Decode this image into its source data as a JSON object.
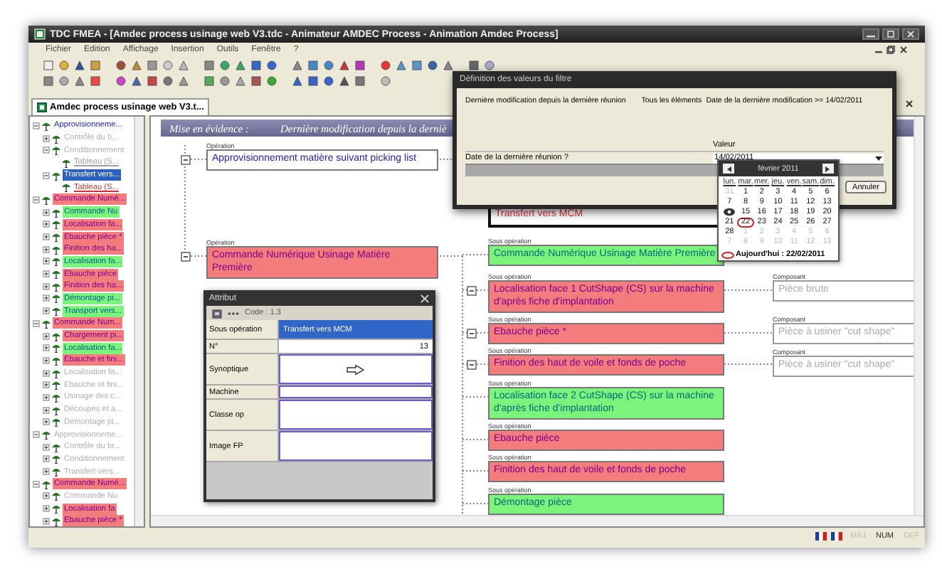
{
  "window": {
    "title": "TDC FMEA - [Amdec process usinage web V3.tdc - Animateur AMDEC Process - Animation Amdec Process]"
  },
  "menu": [
    "Fichier",
    "Edition",
    "Affichage",
    "Insertion",
    "Outils",
    "Fenêtre",
    "?"
  ],
  "document_tab": {
    "label": "Amdec process usinage web V3.t...",
    "selected": true
  },
  "tree": [
    {
      "text": "Approvisionneme...",
      "kind": "step",
      "expanded": true,
      "selected": false,
      "dimmed": false,
      "children": [
        {
          "text": "Contrôle du b...",
          "kind": "step",
          "expanded": false,
          "selected": false,
          "dimmed": true
        },
        {
          "text": "Conditionnement",
          "kind": "step",
          "expanded": true,
          "selected": false,
          "dimmed": true,
          "children": [
            {
              "text": "Tableau (S...",
              "kind": "document",
              "selected": false,
              "dimmed": true
            }
          ]
        },
        {
          "text": "Transfert vers...",
          "kind": "step",
          "expanded": true,
          "selected": true,
          "dimmed": false,
          "children": [
            {
              "text": "Tableau (S...",
              "kind": "document",
              "selected": false,
              "dimmed": false
            }
          ]
        }
      ]
    },
    {
      "text": "Commande Numé...",
      "kind": "step",
      "expanded": true,
      "selected": false,
      "dimmed": false,
      "color": "#f47c7c",
      "children": [
        {
          "text": "Commande Nu",
          "kind": "step",
          "expanded": false,
          "selected": false,
          "dimmed": false,
          "color": "#7cf47c"
        },
        {
          "text": "Localisation fa...",
          "kind": "step",
          "expanded": false,
          "selected": false,
          "dimmed": false,
          "color": "#f47c7c"
        },
        {
          "text": "Ebauche pièce *",
          "kind": "step",
          "expanded": false,
          "selected": false,
          "dimmed": false,
          "color": "#f47c7c"
        },
        {
          "text": "Finition des ha...",
          "kind": "step",
          "expanded": false,
          "selected": false,
          "dimmed": false,
          "color": "#f47c7c"
        },
        {
          "text": "Localisation fa...",
          "kind": "step",
          "expanded": false,
          "selected": false,
          "dimmed": false,
          "color": "#7cf47c"
        },
        {
          "text": "Ebauche pièce",
          "kind": "step",
          "expanded": false,
          "selected": false,
          "dimmed": false,
          "color": "#f47c7c"
        },
        {
          "text": "Finition des ha...",
          "kind": "step",
          "expanded": false,
          "selected": false,
          "dimmed": false,
          "color": "#f47c7c"
        },
        {
          "text": "Démontage pi...",
          "kind": "step",
          "expanded": false,
          "selected": false,
          "dimmed": false,
          "color": "#7cf47c"
        },
        {
          "text": "Transport vers...",
          "kind": "step",
          "expanded": false,
          "selected": false,
          "dimmed": false,
          "color": "#7cf47c"
        }
      ]
    },
    {
      "text": "Commande Num...",
      "kind": "step",
      "expanded": true,
      "selected": false,
      "dimmed": false,
      "color": "#f47c7c",
      "children": [
        {
          "text": "Chargement pi...",
          "kind": "step",
          "expanded": false,
          "selected": false,
          "dimmed": false,
          "color": "#f47c7c"
        },
        {
          "text": "Localisation fa...",
          "kind": "step",
          "expanded": false,
          "selected": false,
          "dimmed": false,
          "color": "#7cf47c"
        },
        {
          "text": "Ebauche et fini...",
          "kind": "step",
          "expanded": false,
          "selected": false,
          "dimmed": false,
          "color": "#f47c7c"
        },
        {
          "text": "Localisation fa...",
          "kind": "step",
          "expanded": false,
          "selected": false,
          "dimmed": true
        },
        {
          "text": "Ebauche et fini...",
          "kind": "step",
          "expanded": false,
          "selected": false,
          "dimmed": true
        },
        {
          "text": "Usinage des c...",
          "kind": "step",
          "expanded": false,
          "selected": false,
          "dimmed": true
        },
        {
          "text": "Découpes et a...",
          "kind": "step",
          "expanded": false,
          "selected": false,
          "dimmed": true
        },
        {
          "text": "Démontage pi...",
          "kind": "step",
          "expanded": false,
          "selected": false,
          "dimmed": true
        }
      ]
    },
    {
      "text": "Approvisionneme...",
      "kind": "step",
      "expanded": true,
      "selected": false,
      "dimmed": true,
      "children": [
        {
          "text": "Contrôle du br...",
          "kind": "step",
          "expanded": false,
          "selected": false,
          "dimmed": true
        },
        {
          "text": "Conditionnement",
          "kind": "step",
          "expanded": false,
          "selected": false,
          "dimmed": true
        },
        {
          "text": "Transfert vers...",
          "kind": "step",
          "expanded": false,
          "selected": false,
          "dimmed": true
        }
      ]
    },
    {
      "text": "Commande Numé...",
      "kind": "step",
      "expanded": true,
      "selected": false,
      "dimmed": false,
      "color": "#f47c7c",
      "children": [
        {
          "text": "Commande Nu",
          "kind": "step",
          "expanded": false,
          "selected": false,
          "dimmed": true
        },
        {
          "text": "Localisation fa",
          "kind": "step",
          "expanded": false,
          "selected": false,
          "dimmed": false,
          "color": "#f47c7c"
        },
        {
          "text": "Ebauche pièce *",
          "kind": "step",
          "expanded": false,
          "selected": false,
          "dimmed": false,
          "color": "#f47c7c"
        }
      ]
    }
  ],
  "highlight_bar": {
    "label": "Mise en évidence :",
    "text": "Dernière modification depuis la derniè"
  },
  "operations": [
    {
      "label": "Opération",
      "text": "Approvisionnement matière suivant picking list",
      "expanded": true,
      "selected": false
    },
    {
      "label": "Opération",
      "text": "Commande Numérique Usinage Matière Première",
      "expanded": true,
      "selected": false,
      "color": "#f47c7c"
    }
  ],
  "sub_operations": [
    {
      "text": "Transfert vers MCM",
      "selected": true
    },
    {
      "label": "Sous opération",
      "text": "Commande Numérique Usinage Matière Première",
      "selected": false,
      "color": "#7cf47c"
    },
    {
      "label": "Sous opération",
      "text": "Localisation face 1 CutShape (CS) sur la machine d'après fiche d'implantation",
      "expanded": true,
      "selected": false,
      "color": "#f47c7c",
      "component": {
        "label": "Composant",
        "text": "Pièce brute"
      }
    },
    {
      "label": "Sous opération",
      "text": "Ebauche pièce *",
      "expanded": true,
      "selected": false,
      "color": "#f47c7c",
      "component": {
        "label": "Composant",
        "text": "Pièce à usiner \"cut shape\""
      }
    },
    {
      "label": "Sous opération",
      "text": "Finition des haut de voile et fonds de poche",
      "expanded": true,
      "selected": false,
      "color": "#f47c7c",
      "component": {
        "label": "Composant",
        "text": "Pièce à usiner \"cut shape\""
      }
    },
    {
      "label": "Sous opération",
      "text": "Localisation face 2 CutShape (CS) sur la machine d'après fiche d'implantation",
      "selected": false,
      "color": "#7cf47c"
    },
    {
      "label": "Sous opération",
      "text": "Ebauche pièce",
      "selected": false,
      "color": "#f47c7c"
    },
    {
      "label": "Sous opération",
      "text": "Finition des haut de voile et fonds de poche",
      "selected": false,
      "color": "#f47c7c"
    },
    {
      "label": "Sous opération",
      "text": "Démontage pièce",
      "selected": false,
      "color": "#7cf47c"
    }
  ],
  "attribute_window": {
    "title": "Attribut",
    "code": "Code : 1.3",
    "rows": [
      {
        "label": "Sous opération",
        "value": "Transfert vers MCM",
        "kind": "text",
        "selected": true
      },
      {
        "label": "N°",
        "value": "13",
        "kind": "text",
        "selected": false
      },
      {
        "label": "Synoptique",
        "kind": "image",
        "selected": false
      },
      {
        "label": "Machine",
        "kind": "text",
        "selected": false
      },
      {
        "label": "Classe op",
        "kind": "text",
        "selected": false
      },
      {
        "label": "Image FP",
        "kind": "text",
        "selected": false
      }
    ]
  },
  "filter_dialog": {
    "title": "Définition des valeurs du filtre",
    "criterion": "Dernière modification depuis la dernière réunion",
    "scope": "Tous les éléments",
    "condition": "Date de la dernière modification >= 14/02/2011",
    "value_header": "Valeur",
    "parameter": "Date de la dernière réunion ?",
    "value": "14/02/2011",
    "buttons": [
      "Annuler"
    ],
    "date_picker": {
      "month": "février 2011",
      "weekdays": [
        "lun.",
        "mar.",
        "mer.",
        "jeu.",
        "ven.",
        "sam.",
        "dim."
      ],
      "days": [
        {
          "day": "31",
          "muted": true,
          "selected": false,
          "today": false
        },
        {
          "day": "1",
          "muted": false,
          "selected": false,
          "today": false
        },
        {
          "day": "2",
          "muted": false,
          "selected": false,
          "today": false
        },
        {
          "day": "3",
          "muted": false,
          "selected": false,
          "today": false
        },
        {
          "day": "4",
          "muted": false,
          "selected": false,
          "today": false
        },
        {
          "day": "5",
          "muted": false,
          "selected": false,
          "today": false
        },
        {
          "day": "6",
          "muted": false,
          "selected": false,
          "today": false
        },
        {
          "day": "7",
          "muted": false,
          "selected": false,
          "today": false
        },
        {
          "day": "8",
          "muted": false,
          "selected": false,
          "today": false
        },
        {
          "day": "9",
          "muted": false,
          "selected": false,
          "today": false
        },
        {
          "day": "10",
          "muted": false,
          "selected": false,
          "today": false
        },
        {
          "day": "11",
          "muted": false,
          "selected": false,
          "today": false
        },
        {
          "day": "12",
          "muted": false,
          "selected": false,
          "today": false
        },
        {
          "day": "13",
          "muted": false,
          "selected": false,
          "today": false
        },
        {
          "muted": false,
          "selected": true,
          "today": false
        },
        {
          "day": "15",
          "muted": false,
          "selected": false,
          "today": false
        },
        {
          "day": "16",
          "muted": false,
          "selected": false,
          "today": false
        },
        {
          "day": "17",
          "muted": false,
          "selected": false,
          "today": false
        },
        {
          "day": "18",
          "muted": false,
          "selected": false,
          "today": false
        },
        {
          "day": "19",
          "muted": false,
          "selected": false,
          "today": false
        },
        {
          "day": "20",
          "muted": false,
          "selected": false,
          "today": false
        },
        {
          "day": "21",
          "muted": false,
          "selected": false,
          "today": false
        },
        {
          "day": "22",
          "muted": false,
          "selected": false,
          "today": true
        },
        {
          "day": "23",
          "muted": false,
          "selected": false,
          "today": false
        },
        {
          "day": "24",
          "muted": false,
          "selected": false,
          "today": false
        },
        {
          "day": "25",
          "muted": false,
          "selected": false,
          "today": false
        },
        {
          "day": "26",
          "muted": false,
          "selected": false,
          "today": false
        },
        {
          "day": "27",
          "muted": false,
          "selected": false,
          "today": false
        },
        {
          "day": "28",
          "muted": false,
          "selected": false,
          "today": false
        },
        {
          "day": "1",
          "muted": true,
          "selected": false,
          "today": false
        },
        {
          "day": "2",
          "muted": true,
          "selected": false,
          "today": false
        },
        {
          "day": "3",
          "muted": true,
          "selected": false,
          "today": false
        },
        {
          "day": "4",
          "muted": true,
          "selected": false,
          "today": false
        },
        {
          "day": "5",
          "muted": true,
          "selected": false,
          "today": false
        },
        {
          "day": "6",
          "muted": true,
          "selected": false,
          "today": false
        },
        {
          "day": "7",
          "muted": true,
          "selected": false,
          "today": false
        },
        {
          "day": "8",
          "muted": true,
          "selected": false,
          "today": false
        },
        {
          "day": "9",
          "muted": true,
          "selected": false,
          "today": false
        },
        {
          "day": "10",
          "muted": true,
          "selected": false,
          "today": false
        },
        {
          "day": "11",
          "muted": true,
          "selected": false,
          "today": false
        },
        {
          "day": "12",
          "muted": true,
          "selected": false,
          "today": false
        },
        {
          "day": "13",
          "muted": true,
          "selected": false,
          "today": false
        }
      ],
      "today_label": "Aujourd'hui : 22/02/2011"
    }
  },
  "status_bar": {
    "indicators": [
      {
        "text": "MAJ",
        "on": false
      },
      {
        "text": "NUM",
        "on": true
      },
      {
        "text": "DEF",
        "on": false
      }
    ]
  }
}
